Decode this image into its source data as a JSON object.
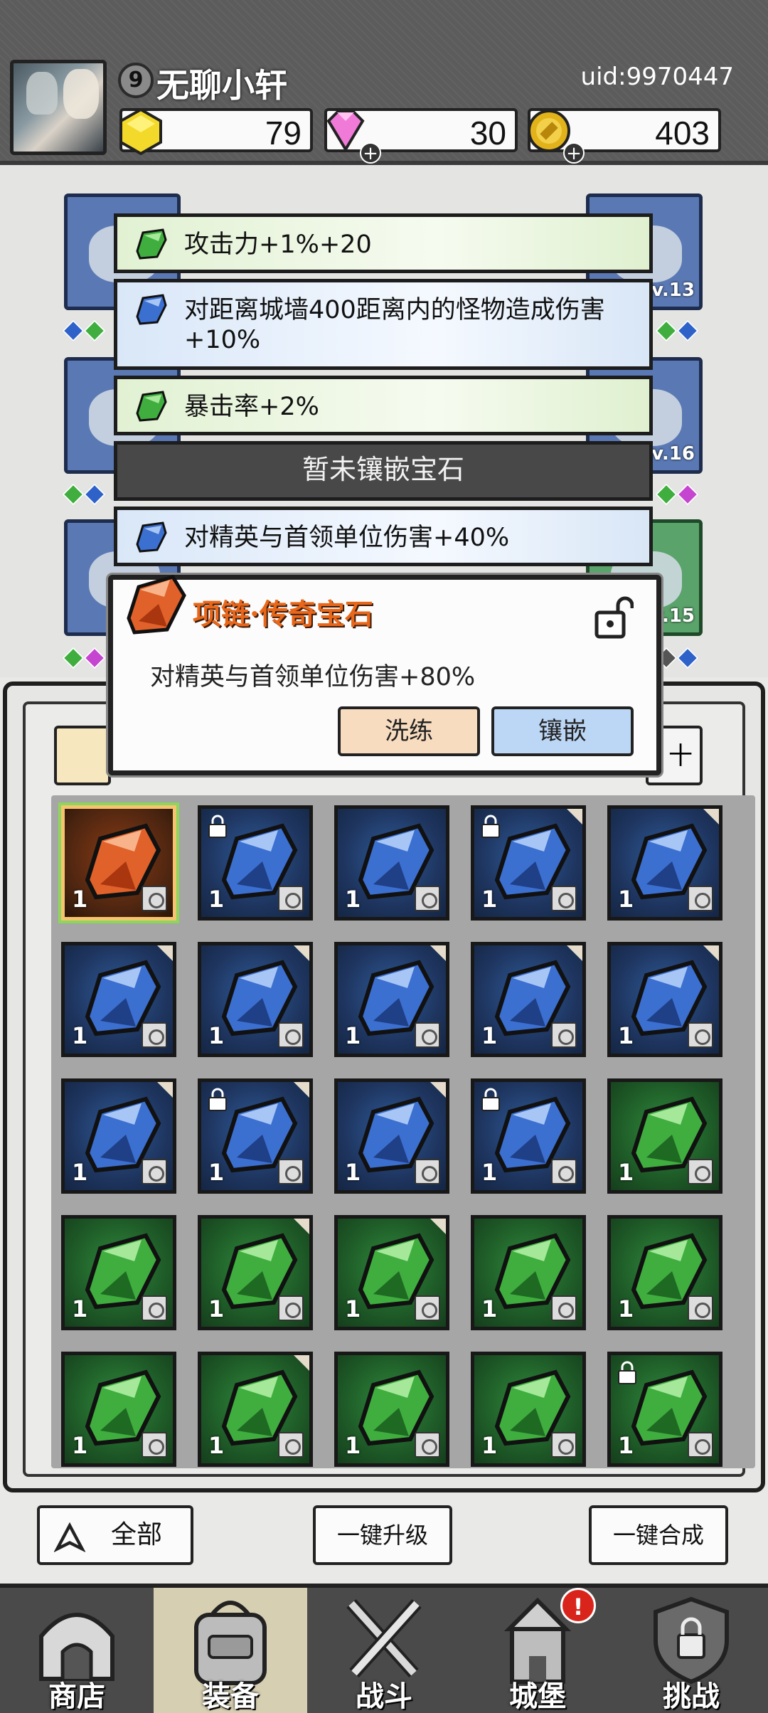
{
  "header": {
    "level": "9",
    "username": "无聊小轩",
    "uid": "uid:9970447",
    "resources": [
      {
        "name": "gold-cube",
        "value": "79",
        "color": "#f3d92a"
      },
      {
        "name": "diamond",
        "value": "30",
        "color": "#f07ad8"
      },
      {
        "name": "coin",
        "value": "403",
        "color": "#e2b21b"
      }
    ]
  },
  "equipment_slots": [
    {
      "lv": ""
    },
    {
      "lv": "Lv.13"
    },
    {
      "lv": ""
    },
    {
      "lv": "Lv.16"
    },
    {
      "lv": ""
    },
    {
      "lv": "v.15"
    }
  ],
  "gem_stats": [
    {
      "type": "green",
      "text": "攻击力+1%+20"
    },
    {
      "type": "blue",
      "text": "对距离城墙400距离内的怪物造成伤害+10%"
    },
    {
      "type": "green",
      "text": "暴击率+2%"
    },
    {
      "type": "empty",
      "text": "暂未镶嵌宝石"
    },
    {
      "type": "blue",
      "text": "对精英与首领单位伤害+40%"
    }
  ],
  "popup": {
    "title": "项链·传奇宝石",
    "description": "对精英与首领单位伤害+80%",
    "refine_label": "洗练",
    "inlay_label": "镶嵌"
  },
  "panel": {
    "sort_label": "十"
  },
  "inventory": [
    {
      "color": "orange",
      "count": "1",
      "locked": false,
      "corner": false
    },
    {
      "color": "blue",
      "count": "1",
      "locked": true,
      "corner": false
    },
    {
      "color": "blue",
      "count": "1",
      "locked": false,
      "corner": false
    },
    {
      "color": "blue",
      "count": "1",
      "locked": true,
      "corner": true
    },
    {
      "color": "blue",
      "count": "1",
      "locked": false,
      "corner": true
    },
    {
      "color": "blue",
      "count": "1",
      "locked": false,
      "corner": true
    },
    {
      "color": "blue",
      "count": "1",
      "locked": false,
      "corner": true
    },
    {
      "color": "blue",
      "count": "1",
      "locked": false,
      "corner": true
    },
    {
      "color": "blue",
      "count": "1",
      "locked": false,
      "corner": true
    },
    {
      "color": "blue",
      "count": "1",
      "locked": false,
      "corner": true
    },
    {
      "color": "blue",
      "count": "1",
      "locked": false,
      "corner": true
    },
    {
      "color": "blue",
      "count": "1",
      "locked": true,
      "corner": true
    },
    {
      "color": "blue",
      "count": "1",
      "locked": false,
      "corner": true
    },
    {
      "color": "blue",
      "count": "1",
      "locked": true,
      "corner": false
    },
    {
      "color": "green",
      "count": "1",
      "locked": false,
      "corner": false
    },
    {
      "color": "green",
      "count": "1",
      "locked": false,
      "corner": false
    },
    {
      "color": "green",
      "count": "1",
      "locked": false,
      "corner": true
    },
    {
      "color": "green",
      "count": "1",
      "locked": false,
      "corner": true
    },
    {
      "color": "green",
      "count": "1",
      "locked": false,
      "corner": false
    },
    {
      "color": "green",
      "count": "1",
      "locked": false,
      "corner": false
    },
    {
      "color": "green",
      "count": "1",
      "locked": false,
      "corner": false
    },
    {
      "color": "green",
      "count": "1",
      "locked": false,
      "corner": true
    },
    {
      "color": "green",
      "count": "1",
      "locked": false,
      "corner": false
    },
    {
      "color": "green",
      "count": "1",
      "locked": false,
      "corner": false
    },
    {
      "color": "green",
      "count": "1",
      "locked": true,
      "corner": false
    }
  ],
  "bottom_buttons": {
    "all_label": "全部",
    "upgrade_label": "一键升级",
    "merge_label": "一键合成"
  },
  "nav": [
    {
      "label": "商店",
      "icon": "shop-icon",
      "active": false,
      "badge": ""
    },
    {
      "label": "装备",
      "icon": "backpack-icon",
      "active": true,
      "badge": ""
    },
    {
      "label": "战斗",
      "icon": "swords-icon",
      "active": false,
      "badge": ""
    },
    {
      "label": "城堡",
      "icon": "castle-icon",
      "active": false,
      "badge": "!"
    },
    {
      "label": "挑战",
      "icon": "shield-lock-icon",
      "active": false,
      "badge": ""
    }
  ],
  "colors": {
    "gem_blue": "#3b6fd0",
    "gem_green": "#3fae3f",
    "gem_orange": "#e0612a",
    "title_orange": "#e8671a"
  }
}
